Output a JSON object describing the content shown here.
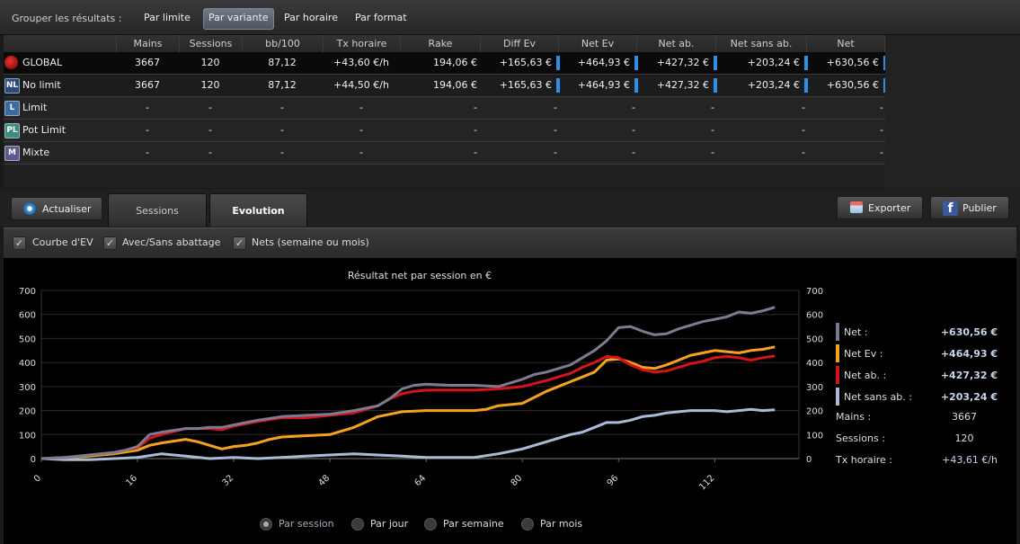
{
  "group_bar": {
    "label": "Grouper les résultats :",
    "options": [
      "Par limite",
      "Par variante",
      "Par horaire",
      "Par format"
    ],
    "active": "Par variante"
  },
  "table": {
    "headers": [
      "Mains",
      "Sessions",
      "bb/100",
      "Tx horaire",
      "Rake",
      "Diff Ev",
      "Net Ev",
      "Net ab.",
      "Net sans ab.",
      "Net"
    ],
    "rows": [
      {
        "badge": "",
        "name": "GLOBAL",
        "cells": [
          "3667",
          "120",
          "87,12",
          "+43,60 €/h",
          "194,06 €",
          "+165,63 €",
          "+464,93 €",
          "+427,32 €",
          "+203,24 €",
          "+630,56 €"
        ]
      },
      {
        "badge": "NL",
        "name": "No limit",
        "cells": [
          "3667",
          "120",
          "87,12",
          "+44,50 €/h",
          "194,06 €",
          "+165,63 €",
          "+464,93 €",
          "+427,32 €",
          "+203,24 €",
          "+630,56 €"
        ]
      },
      {
        "badge": "L",
        "name": "Limit",
        "cells": [
          "-",
          "-",
          "-",
          "-",
          "-",
          "-",
          "-",
          "-",
          "-",
          "-"
        ]
      },
      {
        "badge": "PL",
        "name": "Pot Limit",
        "cells": [
          "-",
          "-",
          "-",
          "-",
          "-",
          "-",
          "-",
          "-",
          "-",
          "-"
        ]
      },
      {
        "badge": "M",
        "name": "Mixte",
        "cells": [
          "-",
          "-",
          "-",
          "-",
          "-",
          "-",
          "-",
          "-",
          "-",
          "-"
        ]
      }
    ]
  },
  "toolbar": {
    "refresh_label": "Actualiser",
    "tabs": [
      "Sessions",
      "Evolution"
    ],
    "active_tab": "Evolution",
    "export_label": "Exporter",
    "publish_label": "Publier",
    "publish_icon": "f"
  },
  "options": {
    "ev_curve": "Courbe d'EV",
    "with_without": "Avec/Sans abattage",
    "nets": "Nets (semaine ou mois)",
    "check_mark": "✓"
  },
  "stats": {
    "items": [
      {
        "label": "Net :",
        "value": "+630,56 €",
        "color": "#7b7b92"
      },
      {
        "label": "Net Ev :",
        "value": "+464,93 €",
        "color": "#f7a21c"
      },
      {
        "label": "Net ab. :",
        "value": "+427,32 €",
        "color": "#d6131b"
      },
      {
        "label": "Net sans ab. :",
        "value": "+203,24 €",
        "color": "#a9bcd7"
      }
    ],
    "mains_label": "Mains :",
    "mains_value": "3667",
    "sessions_label": "Sessions :",
    "sessions_value": "120",
    "tx_label": "Tx horaire :",
    "tx_value": "+43,61 €/h"
  },
  "period": {
    "options": [
      "Par session",
      "Par jour",
      "Par semaine",
      "Par mois"
    ],
    "selected": "Par session"
  },
  "chart_data": {
    "type": "line",
    "title": "Résultat net par session en €",
    "xlabel": "",
    "ylabel": "",
    "xlim": [
      0,
      126
    ],
    "ylim": [
      0,
      700
    ],
    "yticks": [
      0,
      100,
      200,
      300,
      400,
      500,
      600,
      700
    ],
    "xticks": [
      "0",
      "16",
      "32",
      "48",
      "64",
      "80",
      "96",
      "112"
    ],
    "grid": true,
    "series": [
      {
        "name": "Net",
        "color": "#7b7b92",
        "x": [
          0,
          4,
          8,
          12,
          14,
          16,
          18,
          20,
          24,
          26,
          28,
          30,
          32,
          34,
          36,
          40,
          44,
          48,
          52,
          56,
          58,
          60,
          62,
          64,
          68,
          72,
          76,
          80,
          82,
          84,
          88,
          90,
          92,
          94,
          96,
          98,
          100,
          102,
          104,
          106,
          108,
          110,
          112,
          114,
          116,
          118,
          120,
          122
        ],
        "y": [
          0,
          5,
          15,
          25,
          35,
          50,
          100,
          110,
          125,
          125,
          130,
          130,
          140,
          150,
          160,
          175,
          180,
          185,
          200,
          220,
          250,
          290,
          305,
          310,
          305,
          305,
          300,
          330,
          350,
          360,
          390,
          420,
          450,
          490,
          545,
          550,
          530,
          515,
          520,
          540,
          555,
          570,
          580,
          590,
          610,
          605,
          615,
          630
        ]
      },
      {
        "name": "Net Ev",
        "color": "#f7a21c",
        "x": [
          0,
          4,
          8,
          12,
          16,
          18,
          20,
          24,
          26,
          28,
          30,
          32,
          34,
          36,
          38,
          40,
          44,
          48,
          52,
          56,
          60,
          64,
          68,
          72,
          74,
          76,
          80,
          84,
          88,
          90,
          92,
          94,
          96,
          98,
          100,
          102,
          104,
          106,
          108,
          110,
          112,
          114,
          116,
          118,
          120,
          122
        ],
        "y": [
          0,
          5,
          10,
          20,
          35,
          55,
          65,
          80,
          70,
          55,
          40,
          50,
          55,
          65,
          80,
          90,
          95,
          100,
          130,
          175,
          195,
          200,
          200,
          200,
          205,
          220,
          230,
          280,
          320,
          340,
          360,
          410,
          415,
          400,
          380,
          375,
          390,
          410,
          430,
          440,
          450,
          445,
          440,
          450,
          455,
          465
        ]
      },
      {
        "name": "Net ab.",
        "color": "#d6131b",
        "x": [
          0,
          4,
          8,
          12,
          16,
          18,
          20,
          24,
          28,
          30,
          32,
          36,
          40,
          44,
          48,
          52,
          56,
          58,
          60,
          62,
          64,
          68,
          72,
          76,
          80,
          84,
          88,
          90,
          92,
          94,
          96,
          98,
          100,
          102,
          104,
          106,
          108,
          110,
          112,
          114,
          116,
          118,
          120,
          122
        ],
        "y": [
          0,
          5,
          15,
          25,
          45,
          85,
          100,
          125,
          125,
          120,
          135,
          155,
          170,
          170,
          180,
          190,
          220,
          250,
          270,
          280,
          285,
          285,
          285,
          290,
          300,
          325,
          355,
          380,
          400,
          425,
          420,
          390,
          370,
          360,
          365,
          380,
          395,
          405,
          420,
          425,
          420,
          410,
          420,
          427
        ]
      },
      {
        "name": "Net sans ab.",
        "color": "#a9bcd7",
        "x": [
          0,
          4,
          8,
          12,
          16,
          20,
          24,
          28,
          32,
          36,
          40,
          44,
          48,
          52,
          56,
          60,
          64,
          68,
          72,
          76,
          80,
          84,
          88,
          90,
          92,
          94,
          96,
          98,
          100,
          102,
          104,
          106,
          108,
          110,
          112,
          114,
          116,
          118,
          120,
          122
        ],
        "y": [
          0,
          -5,
          -5,
          0,
          5,
          20,
          10,
          0,
          5,
          0,
          5,
          10,
          15,
          20,
          15,
          10,
          5,
          5,
          5,
          20,
          40,
          70,
          100,
          110,
          130,
          150,
          150,
          160,
          175,
          180,
          190,
          195,
          200,
          200,
          200,
          195,
          200,
          205,
          200,
          203
        ]
      }
    ]
  }
}
